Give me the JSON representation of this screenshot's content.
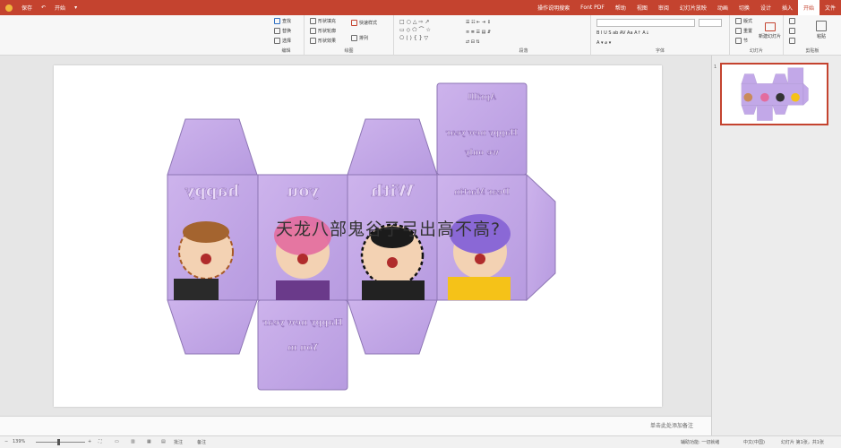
{
  "titlebar": {
    "file_menu": "文件",
    "quick_items": [
      "保存",
      "开始"
    ],
    "tabs": [
      "文件",
      "开始",
      "插入",
      "设计",
      "切换",
      "动画",
      "幻灯片放映",
      "审阅",
      "视图",
      "帮助",
      "Font PDF",
      "操作说明搜索"
    ],
    "active_tab": "开始"
  },
  "ribbon": {
    "groups": [
      "剪贴板",
      "幻灯片",
      "字体",
      "段落",
      "绘图",
      "编辑"
    ],
    "buttons": {
      "paste": "粘贴",
      "new_slide": "新建幻灯片",
      "reset": "重置",
      "section": "节",
      "layout": "版式",
      "arrange": "排列",
      "quick_styles": "快速样式",
      "shape_fill": "形状填充",
      "shape_outline": "形状轮廓",
      "shape_effects": "形状效果",
      "find": "查找",
      "replace": "替换",
      "select": "选择",
      "font_name": "",
      "font_size": ""
    }
  },
  "slide": {
    "overlay_text": "天龙八部鬼谷子弓出高不高?",
    "box_words": [
      "happy",
      "you",
      "With",
      "Dear Martin",
      "Happy new year",
      "You m",
      "Happy new year",
      "we only",
      "Aprilll"
    ]
  },
  "notes": {
    "placeholder": "单击此处添加备注"
  },
  "thumbnails": {
    "current": "1"
  },
  "statusbar": {
    "zoom_pct": "139%",
    "notes_btn": "备注",
    "comments_btn": "批注",
    "slide_info": "幻灯片 第1张，共1张",
    "language": "中文(中国)",
    "accessibility": "辅助功能: 一切就绪"
  }
}
